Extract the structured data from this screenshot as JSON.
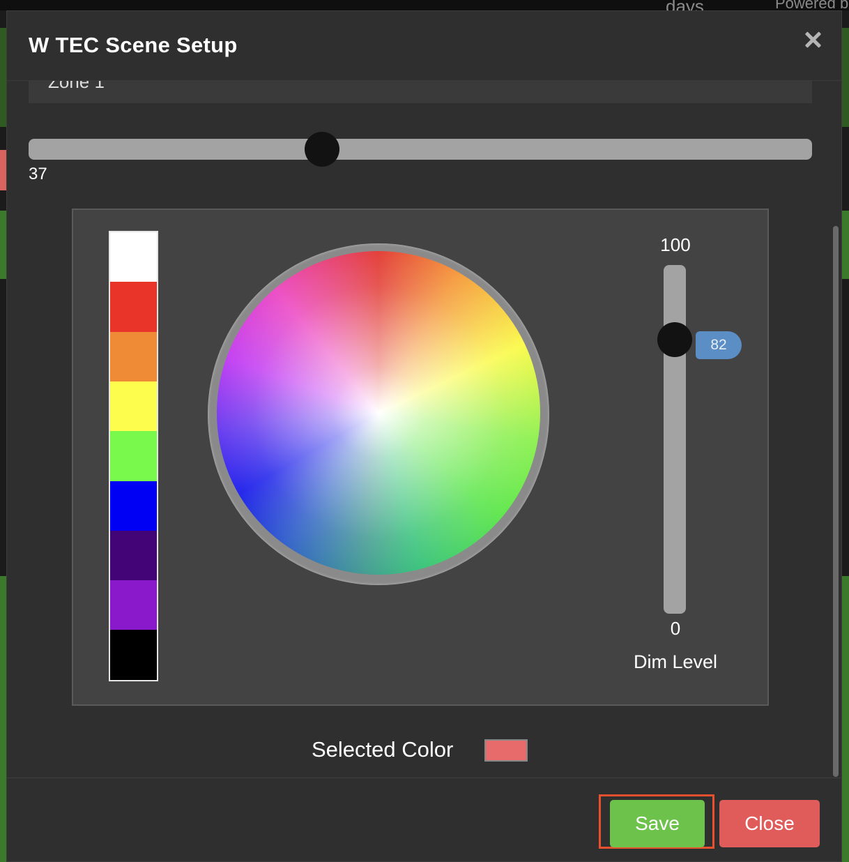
{
  "background": {
    "top_right_text_1": "days",
    "top_right_text_2": "Powered b"
  },
  "modal": {
    "title": "W TEC Scene Setup",
    "zone_value": "Zone 1",
    "brightness_slider": {
      "value": "37",
      "fraction": 0.37
    },
    "swatches": [
      {
        "name": "white",
        "color": "#ffffff"
      },
      {
        "name": "red",
        "color": "#e9342a"
      },
      {
        "name": "orange",
        "color": "#ef8b36"
      },
      {
        "name": "yellow",
        "color": "#fdfd4d"
      },
      {
        "name": "green",
        "color": "#78f94c"
      },
      {
        "name": "blue",
        "color": "#0000f5"
      },
      {
        "name": "indigo",
        "color": "#420477"
      },
      {
        "name": "violet",
        "color": "#8a19cb"
      },
      {
        "name": "black",
        "color": "#000000"
      }
    ],
    "dim_level": {
      "max_label": "100",
      "min_label": "0",
      "value": "82",
      "label": "Dim Level"
    },
    "selected_color": {
      "label": "Selected Color",
      "color": "#e86b6b"
    },
    "buttons": {
      "save": "Save",
      "close": "Close"
    }
  },
  "colors": {
    "save_button": "#6cc24a",
    "close_button": "#e05c5a",
    "highlight": "#e8502e",
    "tooltip": "#5b8ec4"
  }
}
